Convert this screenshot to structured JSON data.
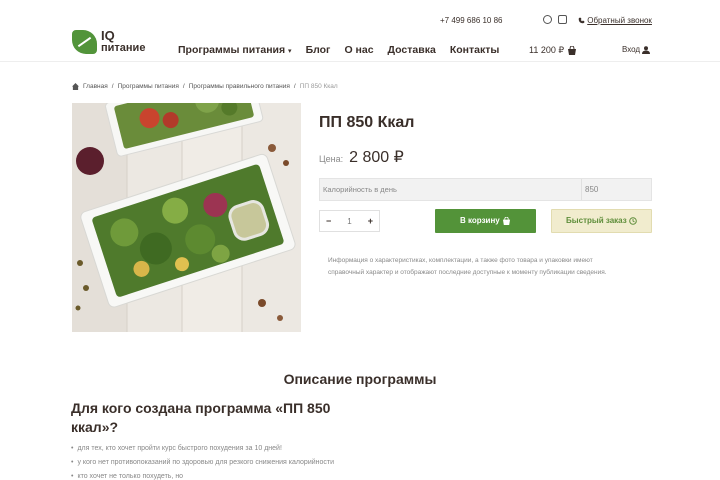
{
  "header": {
    "phone": "+7 499 686 10 86",
    "callback_label": "Обратный звонок",
    "logo_line1": "IQ",
    "logo_line2": "питание",
    "nav": [
      {
        "label": "Программы питания"
      },
      {
        "label": "Блог"
      },
      {
        "label": "О нас"
      },
      {
        "label": "Доставка"
      },
      {
        "label": "Контакты"
      }
    ],
    "cart_sum": "11 200 ₽",
    "login_label": "Вход"
  },
  "breadcrumb": {
    "items": [
      "Главная",
      "Программы питания",
      "Программы правильного питания",
      "ПП 850 Ккал"
    ],
    "separator": "/"
  },
  "product": {
    "title": "ПП 850 Ккал",
    "price_label": "Цена:",
    "price_value": "2 800 ₽",
    "calories_label": "Калорийность в день",
    "calories_value": "850",
    "qty_minus": "−",
    "qty_value": "1",
    "qty_plus": "+",
    "add_to_cart_label": "В корзину",
    "quick_order_label": "Быстрый заказ",
    "info_text": "Информация о характеристиках, комплектации, а также фото товара и упаковки имеют справочный характер и отображают последние доступные к моменту публикации сведения."
  },
  "description": {
    "heading": "Описание программы",
    "for_whom_heading": "Для кого создана программа «ПП 850 ккал»?",
    "bullets": [
      "для тех, кто хочет пройти курс быстрого похудения за 10 дней!",
      "у кого нет противопоказаний по здоровью для резкого снижения калорийности",
      "кто хочет не только похудеть, но"
    ]
  },
  "colors": {
    "brand_green": "#539339",
    "quick_bg": "#f1ecce",
    "text_dark": "#3a2f2a"
  },
  "icons": [
    "whatsapp-icon",
    "instagram-icon",
    "phone-icon",
    "cart-icon",
    "user-icon",
    "home-icon",
    "clock-icon",
    "chevron-down-icon"
  ]
}
